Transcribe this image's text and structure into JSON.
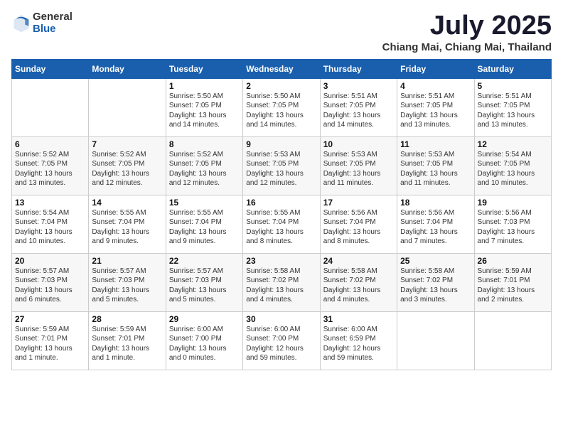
{
  "logo": {
    "general": "General",
    "blue": "Blue"
  },
  "title": "July 2025",
  "location": "Chiang Mai, Chiang Mai, Thailand",
  "days_of_week": [
    "Sunday",
    "Monday",
    "Tuesday",
    "Wednesday",
    "Thursday",
    "Friday",
    "Saturday"
  ],
  "weeks": [
    [
      {
        "day": "",
        "detail": ""
      },
      {
        "day": "",
        "detail": ""
      },
      {
        "day": "1",
        "detail": "Sunrise: 5:50 AM\nSunset: 7:05 PM\nDaylight: 13 hours\nand 14 minutes."
      },
      {
        "day": "2",
        "detail": "Sunrise: 5:50 AM\nSunset: 7:05 PM\nDaylight: 13 hours\nand 14 minutes."
      },
      {
        "day": "3",
        "detail": "Sunrise: 5:51 AM\nSunset: 7:05 PM\nDaylight: 13 hours\nand 14 minutes."
      },
      {
        "day": "4",
        "detail": "Sunrise: 5:51 AM\nSunset: 7:05 PM\nDaylight: 13 hours\nand 13 minutes."
      },
      {
        "day": "5",
        "detail": "Sunrise: 5:51 AM\nSunset: 7:05 PM\nDaylight: 13 hours\nand 13 minutes."
      }
    ],
    [
      {
        "day": "6",
        "detail": "Sunrise: 5:52 AM\nSunset: 7:05 PM\nDaylight: 13 hours\nand 13 minutes."
      },
      {
        "day": "7",
        "detail": "Sunrise: 5:52 AM\nSunset: 7:05 PM\nDaylight: 13 hours\nand 12 minutes."
      },
      {
        "day": "8",
        "detail": "Sunrise: 5:52 AM\nSunset: 7:05 PM\nDaylight: 13 hours\nand 12 minutes."
      },
      {
        "day": "9",
        "detail": "Sunrise: 5:53 AM\nSunset: 7:05 PM\nDaylight: 13 hours\nand 12 minutes."
      },
      {
        "day": "10",
        "detail": "Sunrise: 5:53 AM\nSunset: 7:05 PM\nDaylight: 13 hours\nand 11 minutes."
      },
      {
        "day": "11",
        "detail": "Sunrise: 5:53 AM\nSunset: 7:05 PM\nDaylight: 13 hours\nand 11 minutes."
      },
      {
        "day": "12",
        "detail": "Sunrise: 5:54 AM\nSunset: 7:05 PM\nDaylight: 13 hours\nand 10 minutes."
      }
    ],
    [
      {
        "day": "13",
        "detail": "Sunrise: 5:54 AM\nSunset: 7:04 PM\nDaylight: 13 hours\nand 10 minutes."
      },
      {
        "day": "14",
        "detail": "Sunrise: 5:55 AM\nSunset: 7:04 PM\nDaylight: 13 hours\nand 9 minutes."
      },
      {
        "day": "15",
        "detail": "Sunrise: 5:55 AM\nSunset: 7:04 PM\nDaylight: 13 hours\nand 9 minutes."
      },
      {
        "day": "16",
        "detail": "Sunrise: 5:55 AM\nSunset: 7:04 PM\nDaylight: 13 hours\nand 8 minutes."
      },
      {
        "day": "17",
        "detail": "Sunrise: 5:56 AM\nSunset: 7:04 PM\nDaylight: 13 hours\nand 8 minutes."
      },
      {
        "day": "18",
        "detail": "Sunrise: 5:56 AM\nSunset: 7:04 PM\nDaylight: 13 hours\nand 7 minutes."
      },
      {
        "day": "19",
        "detail": "Sunrise: 5:56 AM\nSunset: 7:03 PM\nDaylight: 13 hours\nand 7 minutes."
      }
    ],
    [
      {
        "day": "20",
        "detail": "Sunrise: 5:57 AM\nSunset: 7:03 PM\nDaylight: 13 hours\nand 6 minutes."
      },
      {
        "day": "21",
        "detail": "Sunrise: 5:57 AM\nSunset: 7:03 PM\nDaylight: 13 hours\nand 5 minutes."
      },
      {
        "day": "22",
        "detail": "Sunrise: 5:57 AM\nSunset: 7:03 PM\nDaylight: 13 hours\nand 5 minutes."
      },
      {
        "day": "23",
        "detail": "Sunrise: 5:58 AM\nSunset: 7:02 PM\nDaylight: 13 hours\nand 4 minutes."
      },
      {
        "day": "24",
        "detail": "Sunrise: 5:58 AM\nSunset: 7:02 PM\nDaylight: 13 hours\nand 4 minutes."
      },
      {
        "day": "25",
        "detail": "Sunrise: 5:58 AM\nSunset: 7:02 PM\nDaylight: 13 hours\nand 3 minutes."
      },
      {
        "day": "26",
        "detail": "Sunrise: 5:59 AM\nSunset: 7:01 PM\nDaylight: 13 hours\nand 2 minutes."
      }
    ],
    [
      {
        "day": "27",
        "detail": "Sunrise: 5:59 AM\nSunset: 7:01 PM\nDaylight: 13 hours\nand 1 minute."
      },
      {
        "day": "28",
        "detail": "Sunrise: 5:59 AM\nSunset: 7:01 PM\nDaylight: 13 hours\nand 1 minute."
      },
      {
        "day": "29",
        "detail": "Sunrise: 6:00 AM\nSunset: 7:00 PM\nDaylight: 13 hours\nand 0 minutes."
      },
      {
        "day": "30",
        "detail": "Sunrise: 6:00 AM\nSunset: 7:00 PM\nDaylight: 12 hours\nand 59 minutes."
      },
      {
        "day": "31",
        "detail": "Sunrise: 6:00 AM\nSunset: 6:59 PM\nDaylight: 12 hours\nand 59 minutes."
      },
      {
        "day": "",
        "detail": ""
      },
      {
        "day": "",
        "detail": ""
      }
    ]
  ]
}
